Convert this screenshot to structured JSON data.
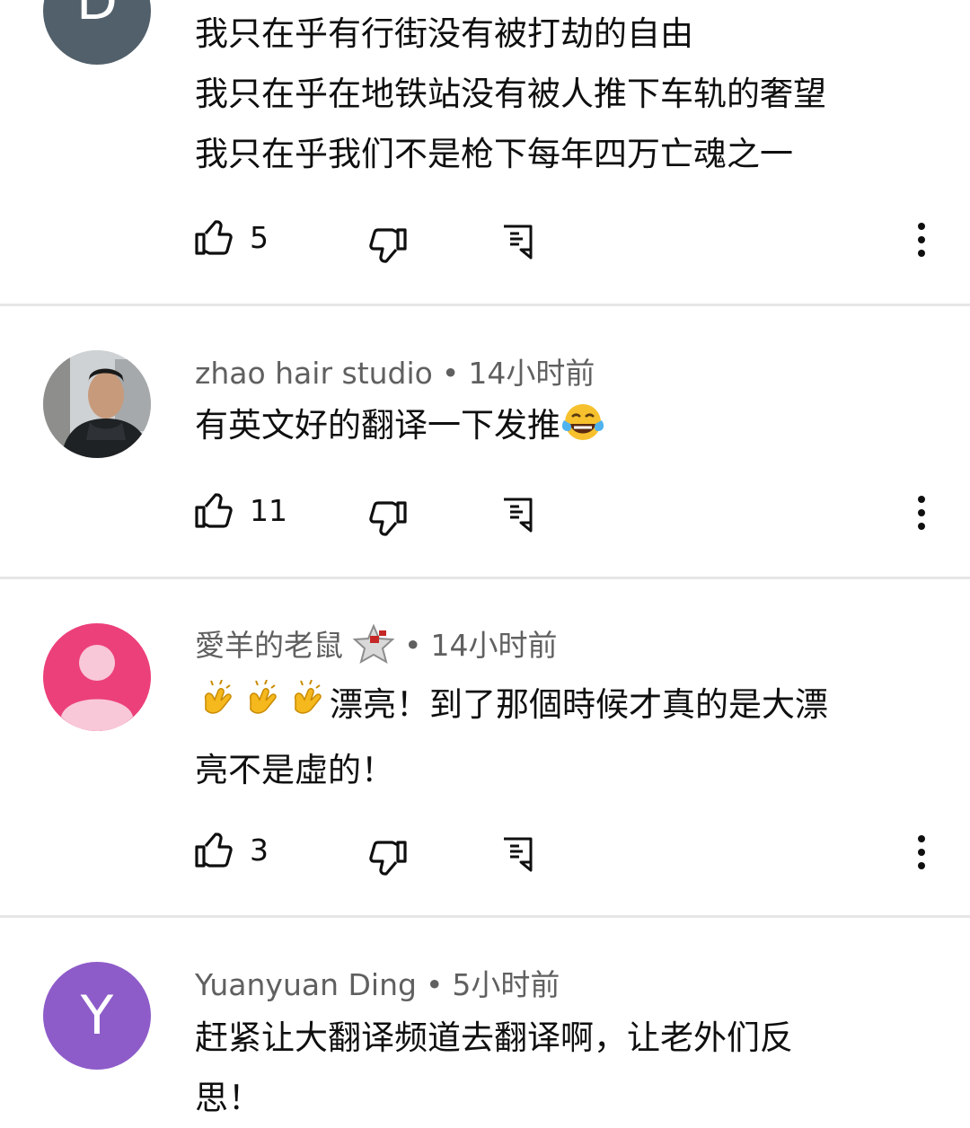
{
  "comments": [
    {
      "author": "",
      "time": "",
      "avatar_letter": "D",
      "lines": [
        "我只在乎有行街没有被打劫的自由",
        "我只在乎在地铁站没有被人推下车轨的奢望",
        "我只在乎我们不是枪下每年四万亡魂之一"
      ],
      "likes": "5"
    },
    {
      "author": "zhao hair studio",
      "time": "14小时前",
      "lines": [
        "有英文好的翻译一下发推"
      ],
      "emoji_suffix": "face-with-tears-of-joy",
      "likes": "11"
    },
    {
      "author": "愛羊的老鼠",
      "time": "14小时前",
      "lines": [
        "漂亮！到了那個時候才真的是大漂",
        "亮不是虛的！"
      ],
      "emoji_prefix": "clapping-hands x3",
      "likes": "3"
    },
    {
      "author": "Yuanyuan Ding",
      "time": "5小时前",
      "avatar_letter": "Y",
      "lines": [
        "赶紧让大翻译频道去翻译啊，让老外们反",
        "思！"
      ],
      "likes": ""
    }
  ],
  "meta_separator": "•",
  "icons": {
    "like": "thumb-up-icon",
    "dislike": "thumb-down-icon",
    "reply": "reply-icon",
    "more": "more-vert-icon"
  },
  "colors": {
    "avatar_d": "#52606b",
    "avatar_pink": "#ec407a",
    "avatar_y": "#8e5cc9",
    "divider": "#e6e6e6",
    "meta_text": "#606060"
  }
}
